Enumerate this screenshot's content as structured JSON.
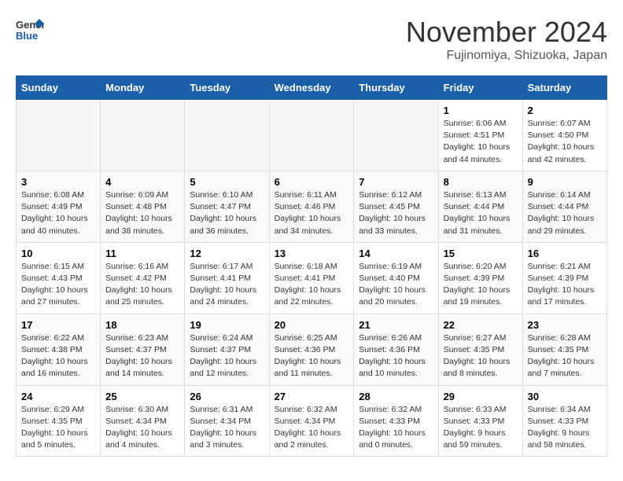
{
  "logo": {
    "line1": "General",
    "line2": "Blue"
  },
  "title": "November 2024",
  "subtitle": "Fujinomiya, Shizuoka, Japan",
  "weekdays": [
    "Sunday",
    "Monday",
    "Tuesday",
    "Wednesday",
    "Thursday",
    "Friday",
    "Saturday"
  ],
  "weeks": [
    [
      {
        "day": "",
        "info": ""
      },
      {
        "day": "",
        "info": ""
      },
      {
        "day": "",
        "info": ""
      },
      {
        "day": "",
        "info": ""
      },
      {
        "day": "",
        "info": ""
      },
      {
        "day": "1",
        "info": "Sunrise: 6:06 AM\nSunset: 4:51 PM\nDaylight: 10 hours and 44 minutes."
      },
      {
        "day": "2",
        "info": "Sunrise: 6:07 AM\nSunset: 4:50 PM\nDaylight: 10 hours and 42 minutes."
      }
    ],
    [
      {
        "day": "3",
        "info": "Sunrise: 6:08 AM\nSunset: 4:49 PM\nDaylight: 10 hours and 40 minutes."
      },
      {
        "day": "4",
        "info": "Sunrise: 6:09 AM\nSunset: 4:48 PM\nDaylight: 10 hours and 38 minutes."
      },
      {
        "day": "5",
        "info": "Sunrise: 6:10 AM\nSunset: 4:47 PM\nDaylight: 10 hours and 36 minutes."
      },
      {
        "day": "6",
        "info": "Sunrise: 6:11 AM\nSunset: 4:46 PM\nDaylight: 10 hours and 34 minutes."
      },
      {
        "day": "7",
        "info": "Sunrise: 6:12 AM\nSunset: 4:45 PM\nDaylight: 10 hours and 33 minutes."
      },
      {
        "day": "8",
        "info": "Sunrise: 6:13 AM\nSunset: 4:44 PM\nDaylight: 10 hours and 31 minutes."
      },
      {
        "day": "9",
        "info": "Sunrise: 6:14 AM\nSunset: 4:44 PM\nDaylight: 10 hours and 29 minutes."
      }
    ],
    [
      {
        "day": "10",
        "info": "Sunrise: 6:15 AM\nSunset: 4:43 PM\nDaylight: 10 hours and 27 minutes."
      },
      {
        "day": "11",
        "info": "Sunrise: 6:16 AM\nSunset: 4:42 PM\nDaylight: 10 hours and 25 minutes."
      },
      {
        "day": "12",
        "info": "Sunrise: 6:17 AM\nSunset: 4:41 PM\nDaylight: 10 hours and 24 minutes."
      },
      {
        "day": "13",
        "info": "Sunrise: 6:18 AM\nSunset: 4:41 PM\nDaylight: 10 hours and 22 minutes."
      },
      {
        "day": "14",
        "info": "Sunrise: 6:19 AM\nSunset: 4:40 PM\nDaylight: 10 hours and 20 minutes."
      },
      {
        "day": "15",
        "info": "Sunrise: 6:20 AM\nSunset: 4:39 PM\nDaylight: 10 hours and 19 minutes."
      },
      {
        "day": "16",
        "info": "Sunrise: 6:21 AM\nSunset: 4:39 PM\nDaylight: 10 hours and 17 minutes."
      }
    ],
    [
      {
        "day": "17",
        "info": "Sunrise: 6:22 AM\nSunset: 4:38 PM\nDaylight: 10 hours and 16 minutes."
      },
      {
        "day": "18",
        "info": "Sunrise: 6:23 AM\nSunset: 4:37 PM\nDaylight: 10 hours and 14 minutes."
      },
      {
        "day": "19",
        "info": "Sunrise: 6:24 AM\nSunset: 4:37 PM\nDaylight: 10 hours and 12 minutes."
      },
      {
        "day": "20",
        "info": "Sunrise: 6:25 AM\nSunset: 4:36 PM\nDaylight: 10 hours and 11 minutes."
      },
      {
        "day": "21",
        "info": "Sunrise: 6:26 AM\nSunset: 4:36 PM\nDaylight: 10 hours and 10 minutes."
      },
      {
        "day": "22",
        "info": "Sunrise: 6:27 AM\nSunset: 4:35 PM\nDaylight: 10 hours and 8 minutes."
      },
      {
        "day": "23",
        "info": "Sunrise: 6:28 AM\nSunset: 4:35 PM\nDaylight: 10 hours and 7 minutes."
      }
    ],
    [
      {
        "day": "24",
        "info": "Sunrise: 6:29 AM\nSunset: 4:35 PM\nDaylight: 10 hours and 5 minutes."
      },
      {
        "day": "25",
        "info": "Sunrise: 6:30 AM\nSunset: 4:34 PM\nDaylight: 10 hours and 4 minutes."
      },
      {
        "day": "26",
        "info": "Sunrise: 6:31 AM\nSunset: 4:34 PM\nDaylight: 10 hours and 3 minutes."
      },
      {
        "day": "27",
        "info": "Sunrise: 6:32 AM\nSunset: 4:34 PM\nDaylight: 10 hours and 2 minutes."
      },
      {
        "day": "28",
        "info": "Sunrise: 6:32 AM\nSunset: 4:33 PM\nDaylight: 10 hours and 0 minutes."
      },
      {
        "day": "29",
        "info": "Sunrise: 6:33 AM\nSunset: 4:33 PM\nDaylight: 9 hours and 59 minutes."
      },
      {
        "day": "30",
        "info": "Sunrise: 6:34 AM\nSunset: 4:33 PM\nDaylight: 9 hours and 58 minutes."
      }
    ]
  ]
}
